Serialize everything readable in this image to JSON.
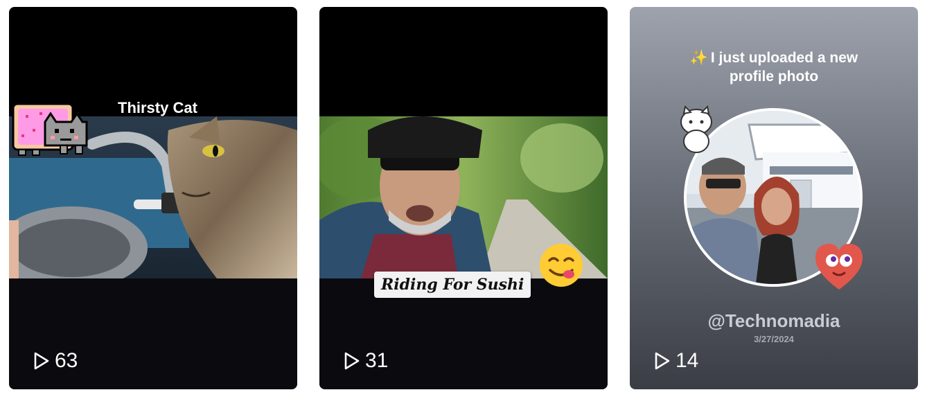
{
  "videos": [
    {
      "overlay_title": "Thirsty Cat",
      "views": "63",
      "thumbnail_icon": "nyan-cat-icon"
    },
    {
      "overlay_title": "Riding For Sushi",
      "views": "31",
      "thumbnail_icon": "yum-face-emoji-icon"
    },
    {
      "overlay_title": "I just uploaded a new profile photo",
      "handle": "@Technomadia",
      "date": "3/27/2024",
      "views": "14",
      "thumbnail_icon": "sparkle-icon"
    }
  ],
  "icons": {
    "views": "play-outline-icon"
  },
  "colors": {
    "card_background": "#000000",
    "text_primary": "#ffffff"
  }
}
